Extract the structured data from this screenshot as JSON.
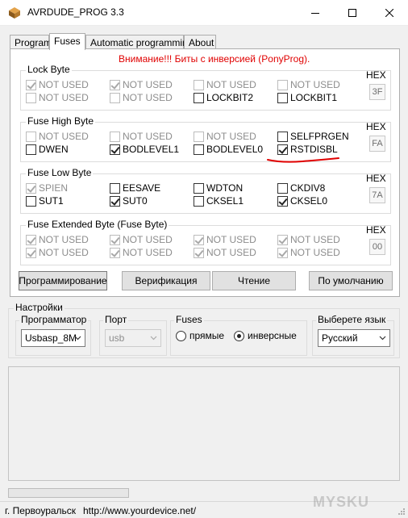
{
  "window": {
    "title": "AVRDUDE_PROG 3.3",
    "controls": {
      "minimize": "minimize-icon",
      "maximize": "maximize-icon",
      "close": "close-icon"
    }
  },
  "tabs": [
    {
      "label": "Program",
      "active": false
    },
    {
      "label": "Fuses",
      "active": true
    },
    {
      "label": "Automatic programming",
      "active": false
    },
    {
      "label": "About",
      "active": false
    }
  ],
  "fuses_tab": {
    "warning": "Внимание!!! Биты с инверсией (PonyProg).",
    "hex_label": "HEX",
    "groups": [
      {
        "title": "Lock Byte",
        "hex": "3F",
        "bits": [
          {
            "label": "NOT USED",
            "checked": true,
            "enabled": false
          },
          {
            "label": "NOT USED",
            "checked": true,
            "enabled": false
          },
          {
            "label": "NOT USED",
            "checked": false,
            "enabled": false
          },
          {
            "label": "NOT USED",
            "checked": false,
            "enabled": false
          },
          {
            "label": "NOT USED",
            "checked": false,
            "enabled": false
          },
          {
            "label": "NOT USED",
            "checked": false,
            "enabled": false
          },
          {
            "label": "LOCKBIT2",
            "checked": false,
            "enabled": true
          },
          {
            "label": "LOCKBIT1",
            "checked": false,
            "enabled": true
          }
        ]
      },
      {
        "title": "Fuse High Byte",
        "hex": "FA",
        "bits": [
          {
            "label": "NOT USED",
            "checked": false,
            "enabled": false
          },
          {
            "label": "NOT USED",
            "checked": false,
            "enabled": false
          },
          {
            "label": "NOT USED",
            "checked": false,
            "enabled": false
          },
          {
            "label": "SELFPRGEN",
            "checked": false,
            "enabled": true
          },
          {
            "label": "DWEN",
            "checked": false,
            "enabled": true
          },
          {
            "label": "BODLEVEL1",
            "checked": true,
            "enabled": true
          },
          {
            "label": "BODLEVEL0",
            "checked": false,
            "enabled": true
          },
          {
            "label": "RSTDISBL",
            "checked": true,
            "enabled": true
          }
        ]
      },
      {
        "title": "Fuse Low Byte",
        "hex": "7A",
        "bits": [
          {
            "label": "SPIEN",
            "checked": true,
            "enabled": false
          },
          {
            "label": "EESAVE",
            "checked": false,
            "enabled": true
          },
          {
            "label": "WDTON",
            "checked": false,
            "enabled": true
          },
          {
            "label": "CKDIV8",
            "checked": false,
            "enabled": true
          },
          {
            "label": "SUT1",
            "checked": false,
            "enabled": true
          },
          {
            "label": "SUT0",
            "checked": true,
            "enabled": true
          },
          {
            "label": "CKSEL1",
            "checked": false,
            "enabled": true
          },
          {
            "label": "CKSEL0",
            "checked": true,
            "enabled": true
          }
        ]
      },
      {
        "title": "Fuse Extended Byte (Fuse Byte)",
        "hex": "00",
        "bits": [
          {
            "label": "NOT USED",
            "checked": true,
            "enabled": false
          },
          {
            "label": "NOT USED",
            "checked": true,
            "enabled": false
          },
          {
            "label": "NOT USED",
            "checked": true,
            "enabled": false
          },
          {
            "label": "NOT USED",
            "checked": true,
            "enabled": false
          },
          {
            "label": "NOT USED",
            "checked": true,
            "enabled": false
          },
          {
            "label": "NOT USED",
            "checked": true,
            "enabled": false
          },
          {
            "label": "NOT USED",
            "checked": true,
            "enabled": false
          },
          {
            "label": "NOT USED",
            "checked": true,
            "enabled": false
          }
        ]
      }
    ],
    "buttons": {
      "program": "Программирование",
      "verify": "Верификация",
      "read": "Чтение",
      "defaults": "По умолчанию"
    }
  },
  "settings": {
    "title": "Настройки",
    "programmer": {
      "label": "Программатор",
      "value": "Usbasp_8M"
    },
    "port": {
      "label": "Порт",
      "value": "usb"
    },
    "fuses": {
      "label": "Fuses",
      "direct": "прямые",
      "inverse": "инверсные",
      "selected": "inverse"
    },
    "language": {
      "label": "Выберете язык",
      "value": "Русский"
    }
  },
  "progress": {
    "value": 0
  },
  "status": {
    "city": "г. Первоуральск",
    "url": "http://www.yourdevice.net/"
  },
  "watermark": "MYSKU",
  "colors": {
    "warning": "#e00000",
    "annotation": "#e00000",
    "accent_dark": "#222222"
  }
}
